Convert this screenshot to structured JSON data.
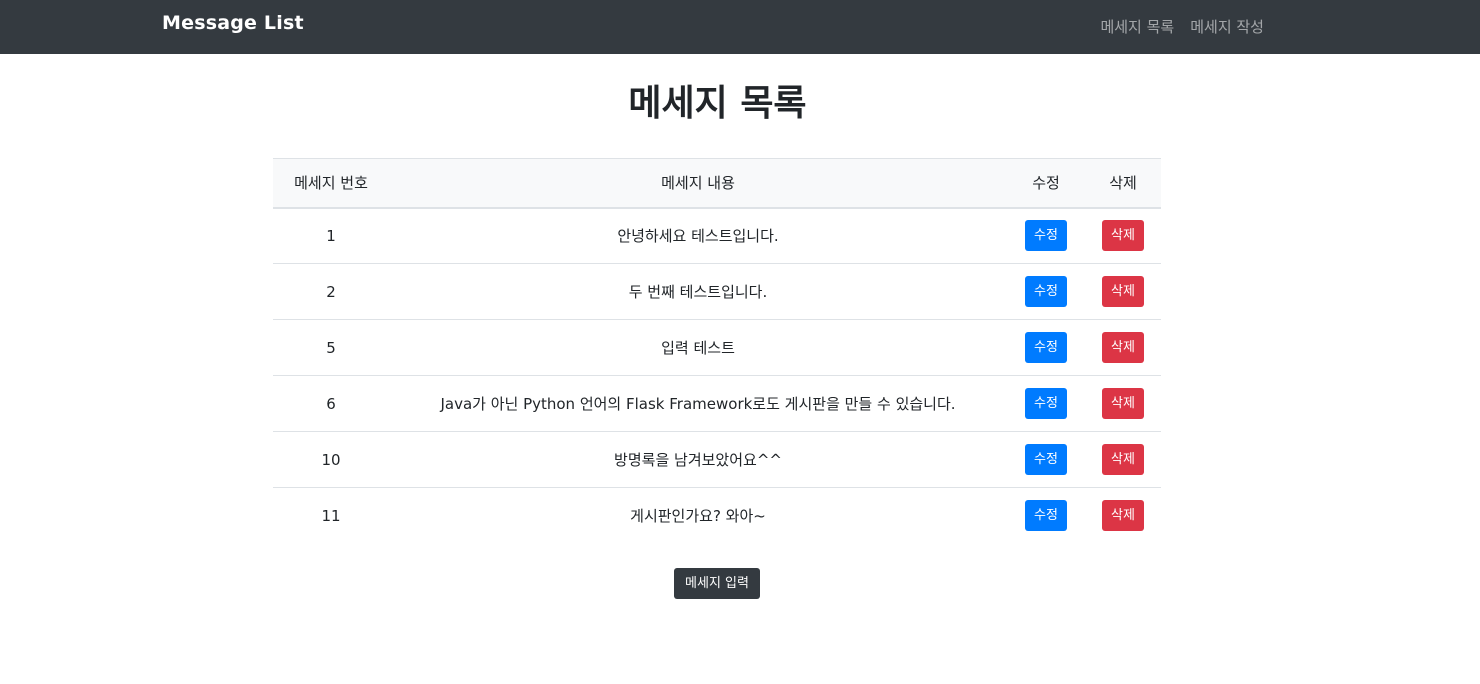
{
  "navbar": {
    "brand": "Message List",
    "links": [
      {
        "label": "메세지 목록"
      },
      {
        "label": "메세지 작성"
      }
    ]
  },
  "page": {
    "title": "메세지 목록"
  },
  "table": {
    "headers": [
      "메세지 번호",
      "메세지 내용",
      "수정",
      "삭제"
    ],
    "rows": [
      {
        "id": "1",
        "content": "안녕하세요 테스트입니다.",
        "edit": "수정",
        "delete": "삭제"
      },
      {
        "id": "2",
        "content": "두 번째 테스트입니다.",
        "edit": "수정",
        "delete": "삭제"
      },
      {
        "id": "5",
        "content": "입력 테스트",
        "edit": "수정",
        "delete": "삭제"
      },
      {
        "id": "6",
        "content": "Java가 아닌 Python 언어의 Flask Framework로도 게시판을 만들 수 있습니다.",
        "edit": "수정",
        "delete": "삭제"
      },
      {
        "id": "10",
        "content": "방명록을 남겨보았어요^^",
        "edit": "수정",
        "delete": "삭제"
      },
      {
        "id": "11",
        "content": "게시판인가요? 와아~",
        "edit": "수정",
        "delete": "삭제"
      }
    ]
  },
  "actions": {
    "submit_label": "메세지 입력"
  },
  "colors": {
    "navbar_bg": "#343a40",
    "primary": "#007bff",
    "danger": "#dc3545",
    "dark": "#343a40"
  }
}
